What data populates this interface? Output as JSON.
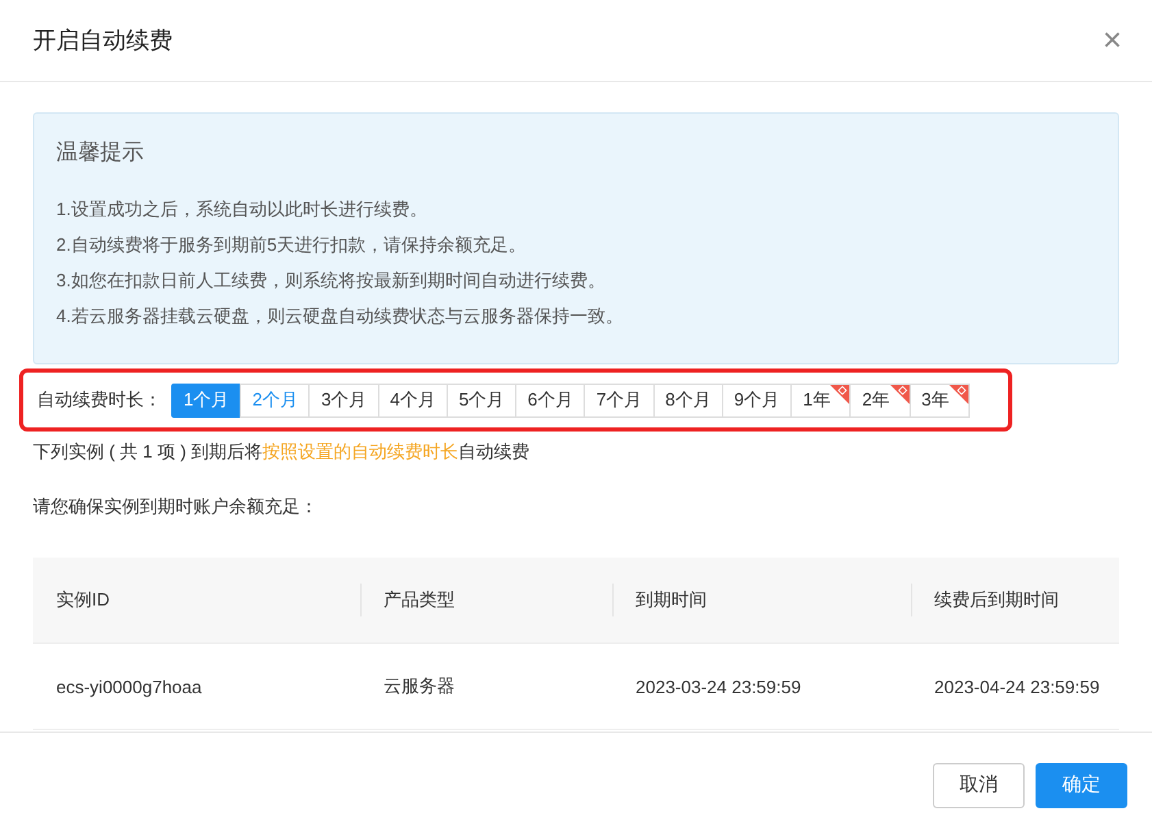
{
  "dialog": {
    "title": "开启自动续费",
    "close": "×"
  },
  "notice": {
    "title": "温馨提示",
    "lines": [
      "1.设置成功之后，系统自动以此时长进行续费。",
      "2.自动续费将于服务到期前5天进行扣款，请保持余额充足。",
      "3.如您在扣款日前人工续费，则系统将按最新到期时间自动进行续费。",
      "4.若云服务器挂载云硬盘，则云硬盘自动续费状态与云服务器保持一致。"
    ]
  },
  "duration": {
    "label": "自动续费时长：",
    "highlighted": true,
    "options": [
      {
        "label": "1个月",
        "selected": true,
        "hovered": false,
        "badge": false
      },
      {
        "label": "2个月",
        "selected": false,
        "hovered": true,
        "badge": false
      },
      {
        "label": "3个月",
        "selected": false,
        "hovered": false,
        "badge": false
      },
      {
        "label": "4个月",
        "selected": false,
        "hovered": false,
        "badge": false
      },
      {
        "label": "5个月",
        "selected": false,
        "hovered": false,
        "badge": false
      },
      {
        "label": "6个月",
        "selected": false,
        "hovered": false,
        "badge": false
      },
      {
        "label": "7个月",
        "selected": false,
        "hovered": false,
        "badge": false
      },
      {
        "label": "8个月",
        "selected": false,
        "hovered": false,
        "badge": false
      },
      {
        "label": "9个月",
        "selected": false,
        "hovered": false,
        "badge": false
      },
      {
        "label": "1年",
        "selected": false,
        "hovered": false,
        "badge": true
      },
      {
        "label": "2年",
        "selected": false,
        "hovered": false,
        "badge": true
      },
      {
        "label": "3年",
        "selected": false,
        "hovered": false,
        "badge": true
      }
    ]
  },
  "summary": [
    {
      "text": "下列实例 ( 共 1 项 ) 到期后将",
      "highlighted": false
    },
    {
      "text": "按照设置的自动续费时长",
      "highlighted": true
    },
    {
      "text": "自动续费",
      "highlighted": false
    }
  ],
  "reminder": "请您确保实例到期时账户余额充足：",
  "table": {
    "columns": [
      "实例ID",
      "产品类型",
      "到期时间",
      "续费后到期时间"
    ],
    "rows": [
      [
        "ecs-yi0000g7hoaa",
        "云服务器",
        "2023-03-24 23:59:59",
        "2023-04-24 23:59:59"
      ]
    ]
  },
  "buttons": [
    {
      "label": "取消",
      "kind": "secondary"
    },
    {
      "label": "确定",
      "kind": "primary"
    }
  ]
}
